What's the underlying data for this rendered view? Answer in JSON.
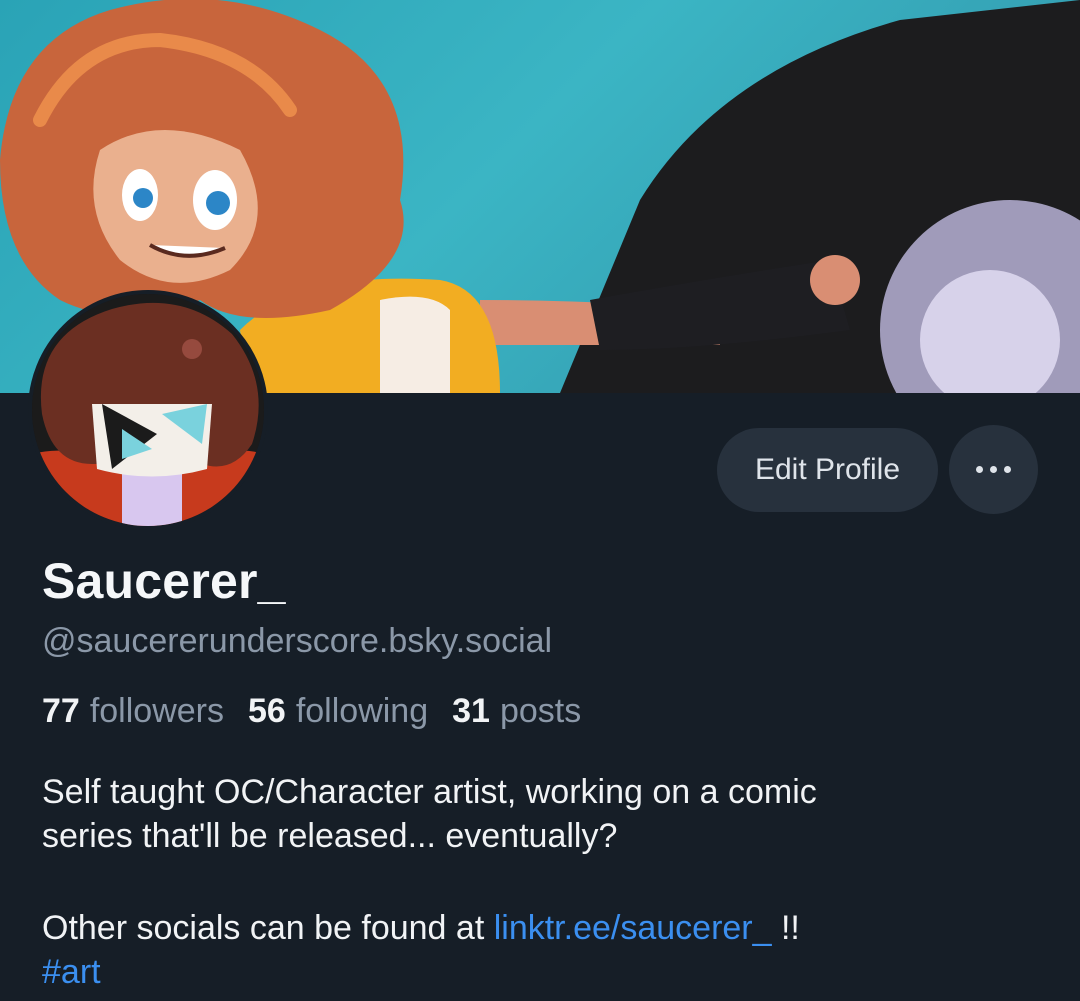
{
  "profile": {
    "display_name": "Saucerer_",
    "handle": "@saucererunderscore.bsky.social",
    "stats": {
      "followers_count": "77",
      "followers_label": "followers",
      "following_count": "56",
      "following_label": "following",
      "posts_count": "31",
      "posts_label": "posts"
    },
    "bio": {
      "line1": "Self taught OC/Character artist, working on a comic",
      "line2": "series that'll be released... eventually?",
      "line3_prefix": "Other socials can be found at",
      "link_text": "linktr.ee/saucerer_",
      "line3_suffix": "!!",
      "hashtag": "#art"
    }
  },
  "actions": {
    "edit_profile_label": "Edit Profile",
    "more_icon": "ellipsis-icon"
  },
  "colors": {
    "background": "#161e27",
    "button_bg": "#27313d",
    "muted_text": "#8b98a8",
    "link": "#3b8ff0",
    "banner_sky": "#2aa3b6"
  }
}
